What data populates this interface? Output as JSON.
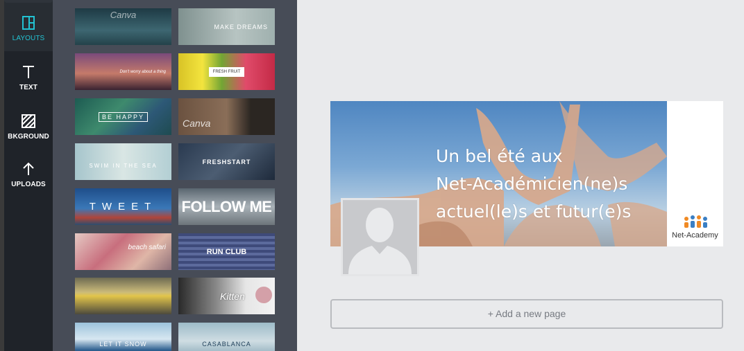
{
  "sidebar": {
    "items": [
      {
        "label": "LAYOUTS",
        "icon": "layouts-icon",
        "active": true
      },
      {
        "label": "TEXT",
        "icon": "text-icon",
        "active": false
      },
      {
        "label": "BKGROUND",
        "icon": "background-icon",
        "active": false
      },
      {
        "label": "UPLOADS",
        "icon": "upload-icon",
        "active": false
      }
    ],
    "accent_color": "#22c3d3"
  },
  "layouts": {
    "thumbnails": [
      {
        "text": "Canva"
      },
      {
        "text": "MAKE DREAMS"
      },
      {
        "text": "Don't worry about a thing"
      },
      {
        "text": "FRESH FRUIT"
      },
      {
        "text": "BE HAPPY"
      },
      {
        "text": "Canva"
      },
      {
        "text": "SWIM IN THE SEA"
      },
      {
        "text": "FRESHSTART"
      },
      {
        "text": "TWEET"
      },
      {
        "text": "FOLLOW ME"
      },
      {
        "text": "beach safari"
      },
      {
        "text": "RUN CLUB"
      },
      {
        "text": ""
      },
      {
        "text": "Kitten"
      },
      {
        "text": "LET IT SNOW"
      },
      {
        "text": "CASABLANCA"
      }
    ]
  },
  "design": {
    "headline_lines": [
      "Un bel été aux",
      "Net-Académicien(ne)s",
      "actuel(le)s et futur(e)s"
    ],
    "logo_text": "Net-Academy"
  },
  "add_page": {
    "label": "+ Add a new page"
  }
}
